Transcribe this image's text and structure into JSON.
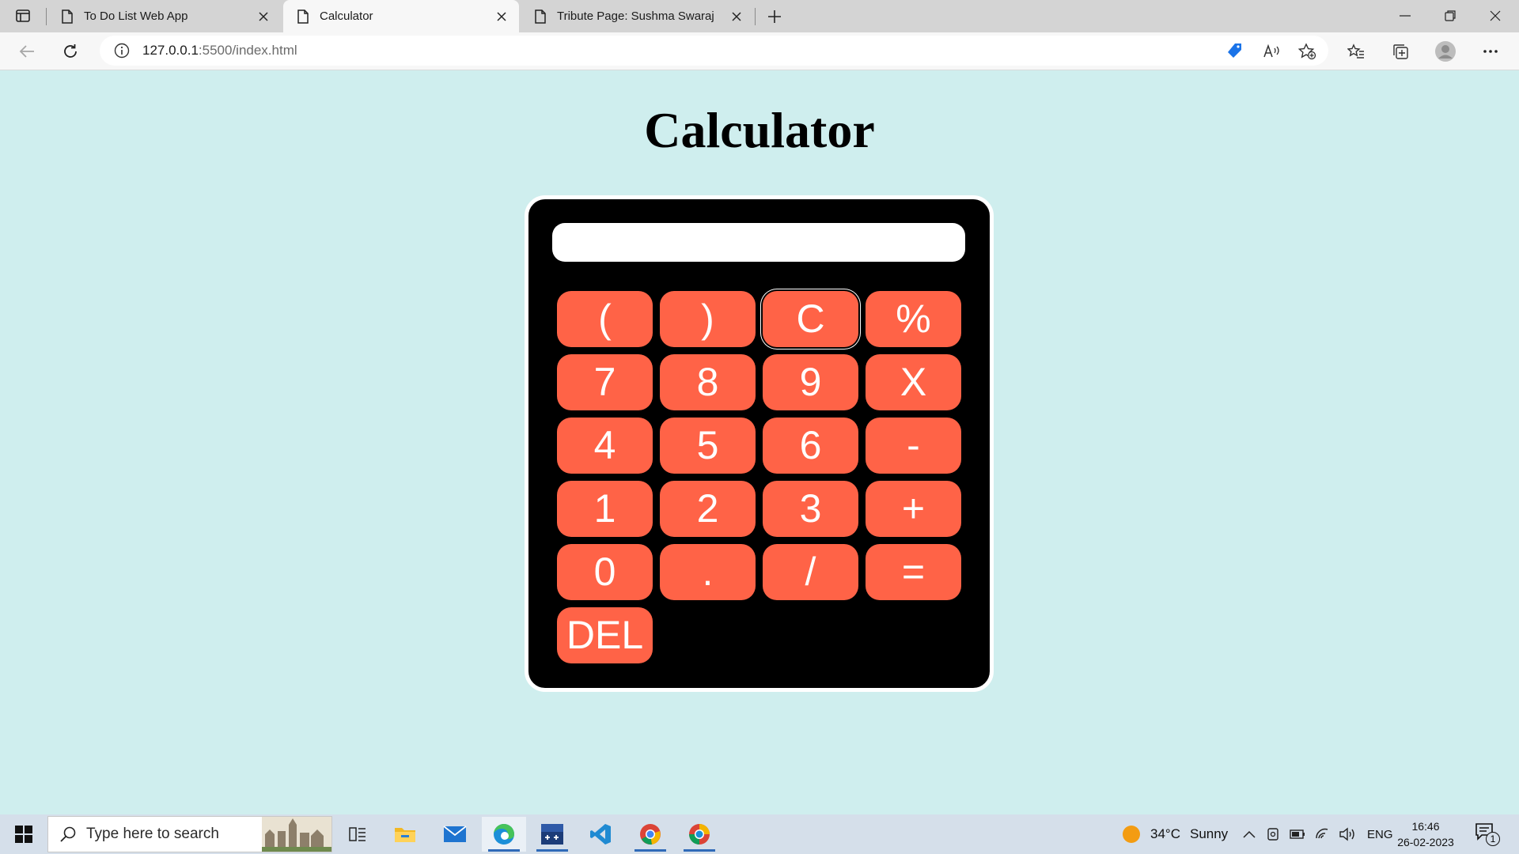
{
  "browser": {
    "tabs": [
      {
        "title": "To Do List Web App",
        "active": false
      },
      {
        "title": "Calculator",
        "active": true
      },
      {
        "title": "Tribute Page: Sushma Swaraj",
        "active": false
      }
    ],
    "address": {
      "url_host": "127.0.0.1",
      "url_rest": ":5500/index.html"
    }
  },
  "page": {
    "title": "Calculator",
    "display_value": "",
    "keys": [
      "(",
      ")",
      "C",
      "%",
      "7",
      "8",
      "9",
      "X",
      "4",
      "5",
      "6",
      "-",
      "1",
      "2",
      "3",
      "+",
      "0",
      ".",
      "/",
      "=",
      "DEL"
    ],
    "focused_key": "C",
    "colors": {
      "background": "#cfeeee",
      "calculator": "#000000",
      "key": "#ff6347",
      "key_text": "#ffffff"
    }
  },
  "taskbar": {
    "search_placeholder": "Type here to search",
    "apps": [
      "task-view",
      "file-explorer",
      "mail",
      "edge",
      "dev-cpp",
      "vscode",
      "chrome",
      "edge-beta"
    ],
    "weather": {
      "temp": "34°C",
      "condition": "Sunny"
    },
    "language": "ENG",
    "time": "16:46",
    "date": "26-02-2023",
    "notification_count": "1"
  }
}
